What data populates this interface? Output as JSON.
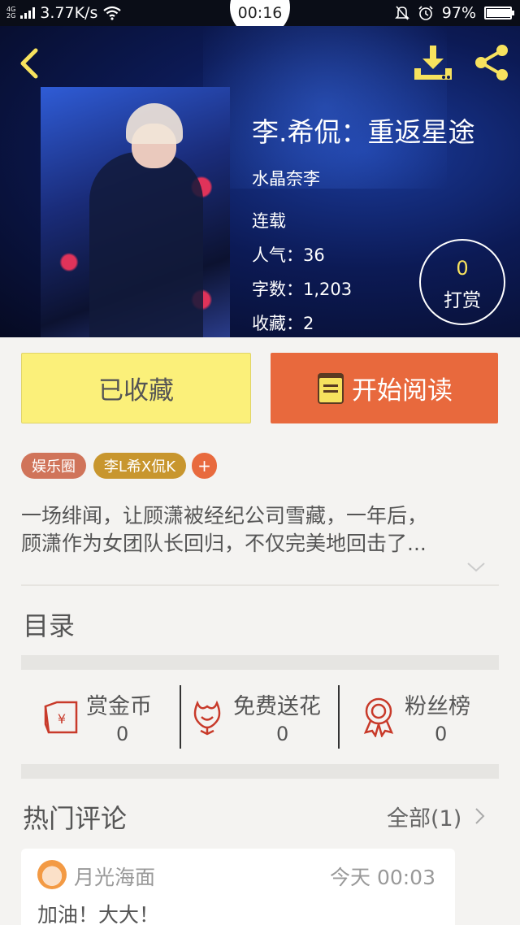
{
  "status_bar": {
    "network_type_top": "4G",
    "network_type_bottom": "2G",
    "speed": "3.77K/s",
    "time": "00:16",
    "battery": "97%",
    "battery_level": 0.97
  },
  "header": {
    "back_icon": "chevron-left-icon",
    "download_icon": "download-icon",
    "share_icon": "share-icon",
    "icon_color": "#f7e25e"
  },
  "book": {
    "title": "李.希侃：重返星途",
    "author": "水晶奈李",
    "status": "连载",
    "popularity": "人气：36",
    "word_count": "字数：1,203",
    "favorites": "收藏：2"
  },
  "reward": {
    "count": "0",
    "label": "打赏"
  },
  "actions": {
    "collected_label": "已收藏",
    "read_label": "开始阅读"
  },
  "tags": {
    "tag1": "娱乐圈",
    "tag2": "李L希X侃K",
    "add": "+"
  },
  "synopsis": {
    "line1": "一场绯闻，让顾潇被经纪公司雪藏，一年后，",
    "line2": "顾潇作为女团队长回归，不仅完美地回击了..."
  },
  "toc": {
    "title": "目录"
  },
  "stats": {
    "gold": {
      "label": "赏金币",
      "value": "0",
      "icon": "red-envelope-icon"
    },
    "flowers": {
      "label": "免费送花",
      "value": "0",
      "icon": "flower-icon"
    },
    "fans": {
      "label": "粉丝榜",
      "value": "0",
      "icon": "ribbon-medal-icon"
    }
  },
  "hot_comments": {
    "title": "热门评论",
    "all_link": "全部(1)",
    "items": [
      {
        "user": "月光海面",
        "time": "今天 00:03",
        "text": "加油！大大！"
      }
    ]
  },
  "colors": {
    "collected_bg": "#fbf07a",
    "read_bg": "#e8693d",
    "accent_red": "#c83a2a"
  }
}
